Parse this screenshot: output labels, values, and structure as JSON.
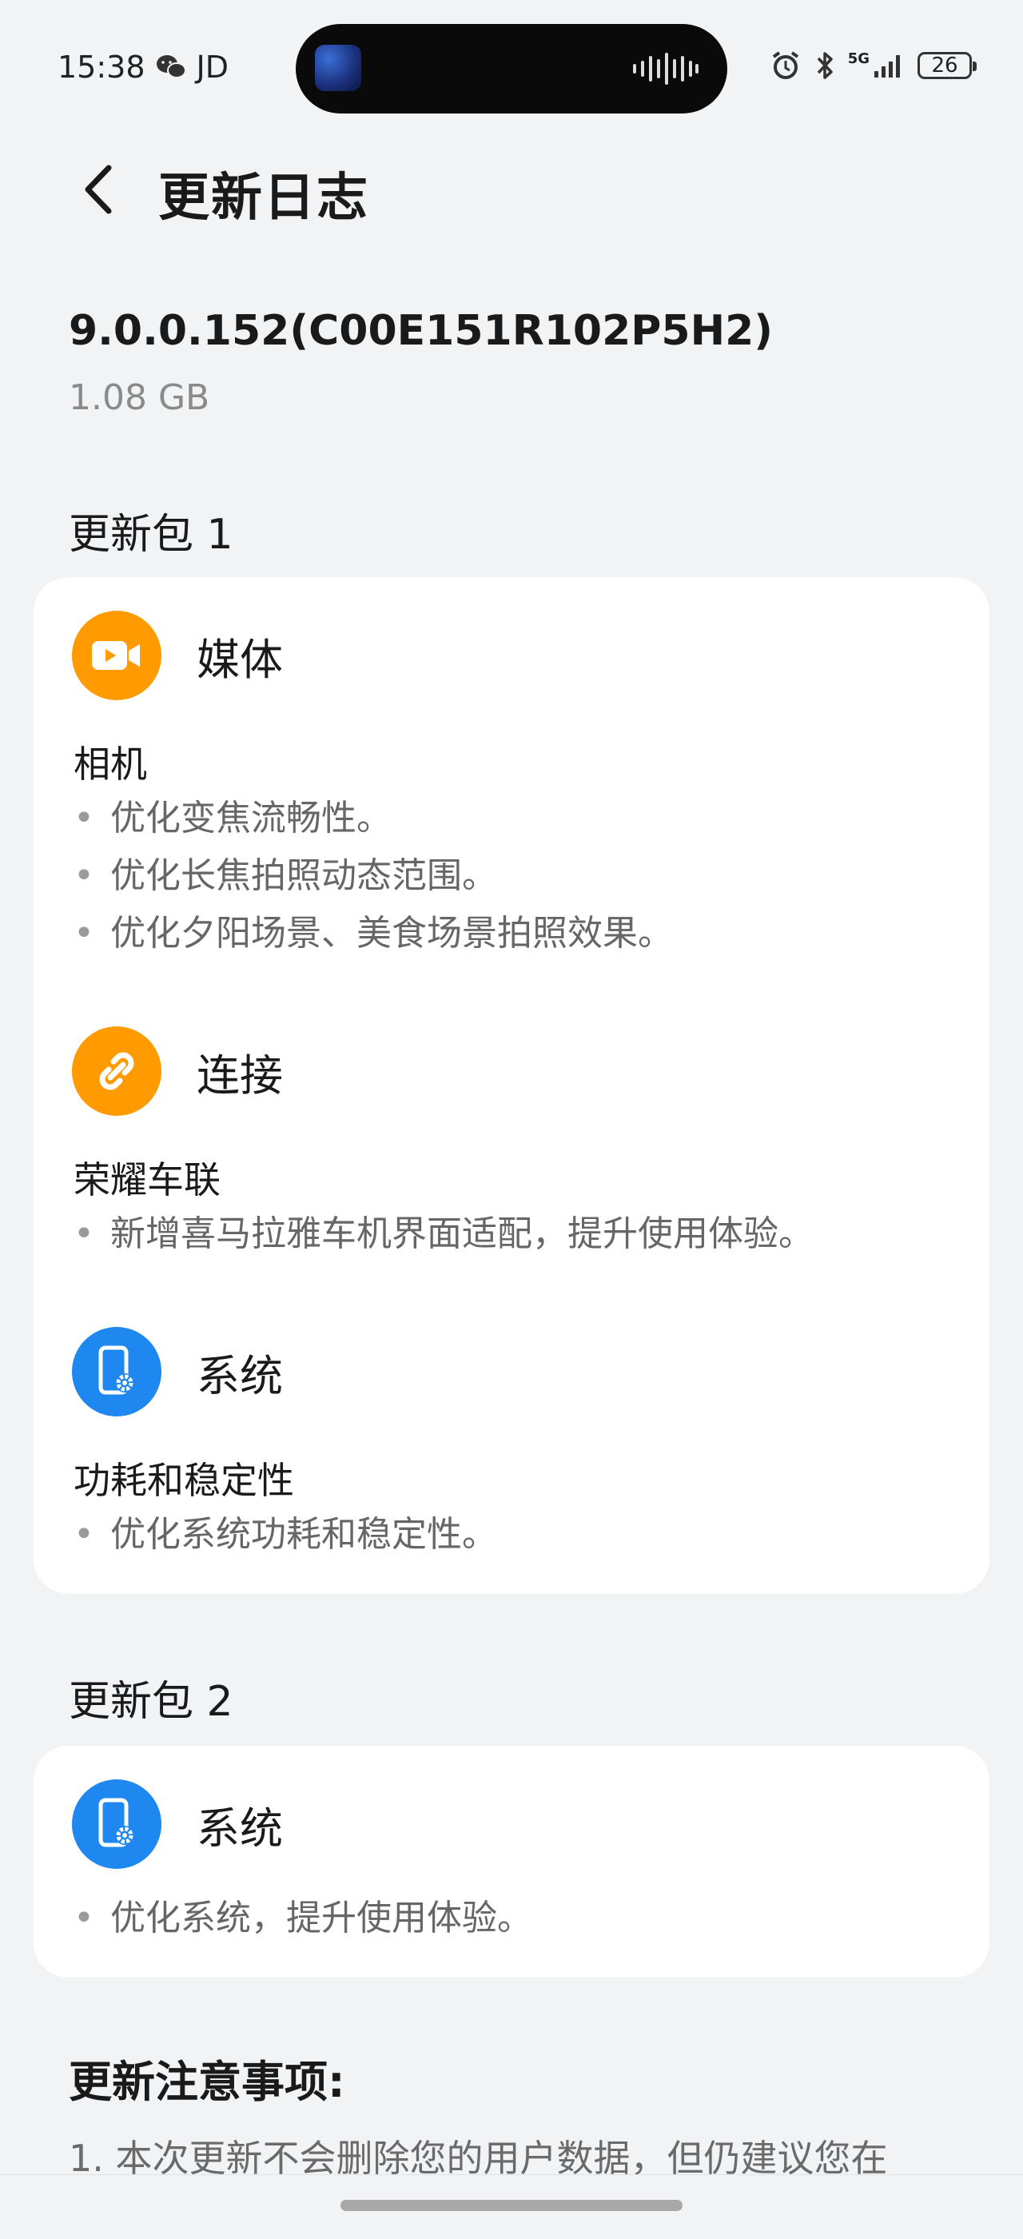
{
  "status_bar": {
    "time": "15:38",
    "carrier_text": "JD",
    "network": "5G",
    "battery": "26"
  },
  "header": {
    "title": "更新日志",
    "back_icon": "chevron-left-icon"
  },
  "version": {
    "number": "9.0.0.152(C00E151R102P5H2)",
    "size": "1.08 GB"
  },
  "packages": [
    {
      "label": "更新包 1",
      "categories": [
        {
          "name": "媒体",
          "icon": "video-camera-icon",
          "color": "#ff9a00",
          "subtitle": "相机",
          "items": [
            "优化变焦流畅性。",
            "优化长焦拍照动态范围。",
            "优化夕阳场景、美食场景拍照效果。"
          ]
        },
        {
          "name": "连接",
          "icon": "link-icon",
          "color": "#ff9a00",
          "subtitle": "荣耀车联",
          "items": [
            "新增喜马拉雅车机界面适配，提升使用体验。"
          ]
        },
        {
          "name": "系统",
          "icon": "phone-settings-icon",
          "color": "#1e87f0",
          "subtitle": "功耗和稳定性",
          "items": [
            "优化系统功耗和稳定性。"
          ]
        }
      ]
    },
    {
      "label": "更新包 2",
      "categories": [
        {
          "name": "系统",
          "icon": "phone-settings-icon",
          "color": "#1e87f0",
          "items": [
            "优化系统，提升使用体验。"
          ]
        }
      ]
    }
  ],
  "notes": {
    "title": "更新注意事项:",
    "first_line": "1. 本次更新不会删除您的用户数据，但仍建议您在"
  },
  "bullet": "•"
}
